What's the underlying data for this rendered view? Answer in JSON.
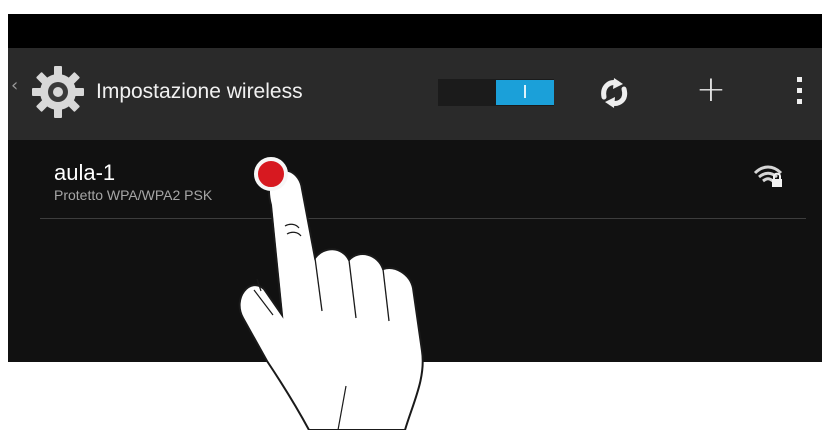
{
  "header": {
    "title": "Impostazione wireless",
    "up_icon": "chevron-left-icon",
    "settings_icon": "gear-icon",
    "wifi_toggle": "I",
    "refresh_icon": "refresh-icon",
    "add_icon": "plus-icon",
    "add_label": "+",
    "overflow_icon": "more-vertical-icon"
  },
  "networks": [
    {
      "ssid": "aula-1",
      "security": "Protetto WPA/WPA2 PSK",
      "signal_icon": "wifi-lock-icon"
    }
  ],
  "overlay": {
    "touch_marker_icon": "tap-marker-icon",
    "hand_icon": "pointing-hand-icon"
  },
  "colors": {
    "accent": "#1ba0d9",
    "action_bar": "#2a2a2a",
    "screen_background": "#111111",
    "status_bar": "#000000",
    "touch_marker": "#d71920"
  }
}
